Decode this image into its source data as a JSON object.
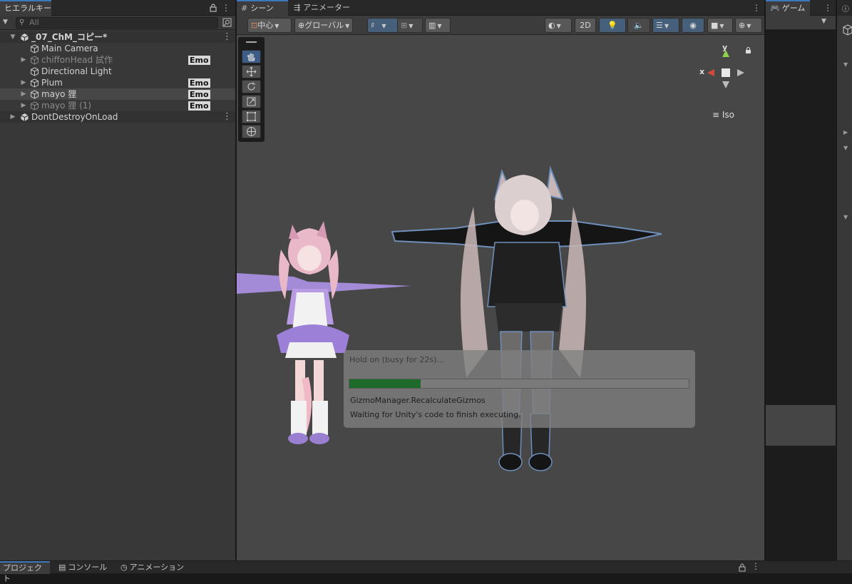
{
  "hierarchy": {
    "tab": "ヒエラルキー",
    "search_placeholder": "All",
    "items": [
      {
        "label": "_07_ChM_コピー*",
        "kind": "scene",
        "badge": "",
        "expanded": true
      },
      {
        "label": "Main Camera",
        "kind": "object",
        "badge": ""
      },
      {
        "label": "chiffonHead  試作",
        "kind": "object",
        "badge": "Emo",
        "dim": true
      },
      {
        "label": "Directional Light",
        "kind": "object",
        "badge": ""
      },
      {
        "label": "Plum",
        "kind": "object",
        "badge": "Emo"
      },
      {
        "label": "mayo 狸",
        "kind": "object",
        "badge": "Emo",
        "selected": true
      },
      {
        "label": "mayo 狸 (1)",
        "kind": "object",
        "badge": "Emo",
        "dim": true
      },
      {
        "label": "DontDestroyOnLoad",
        "kind": "scene",
        "badge": ""
      }
    ]
  },
  "scene": {
    "tabs": [
      {
        "label": "シーン",
        "icon": "grid-icon",
        "active": true
      },
      {
        "label": "アニメーター",
        "icon": "animator-icon",
        "active": false
      }
    ],
    "toolbar": {
      "pivot_label": "中心",
      "space_label": "グローバル",
      "mode_2d": "2D"
    },
    "gizmo": {
      "x_label": "x",
      "y_label": "y",
      "projection_label": "Iso"
    },
    "progress": {
      "title": "Hold on (busy for 22s)...",
      "fraction": 0.21,
      "operation": "GizmoManager.RecalculateGizmos",
      "message": "Waiting for Unity's code to finish executing."
    }
  },
  "game": {
    "tab": "ゲーム"
  },
  "bottom": {
    "tabs": [
      {
        "label": "プロジェクト",
        "active": true
      },
      {
        "label": "コンソール",
        "active": false
      },
      {
        "label": "アニメーション",
        "active": false
      }
    ]
  },
  "colors": {
    "accent": "#3a79bb",
    "progress_fill": "#1e6a2a",
    "badge_bg": "#d8d8d8",
    "viewport_bg": "#474747",
    "axis_x": "#d44b3b",
    "axis_y": "#8ed14b"
  }
}
